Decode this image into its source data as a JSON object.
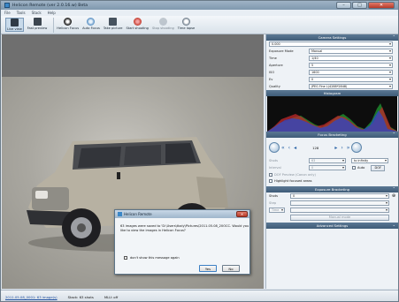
{
  "window": {
    "title": "Helicon Remote (ver 2.0.16.w) Beta"
  },
  "menu": [
    "File",
    "Tools",
    "Stack",
    "Help"
  ],
  "toolbar": {
    "live_view": "Live view",
    "fast_preview": "Fast preview",
    "helicon_focus": "Helicon Focus",
    "auto_focus": "Auto Focus",
    "take_picture": "Take picture",
    "start_shooting": "Start shooting",
    "stop_shooting": "Stop shooting",
    "time_lapse": "Time lapse"
  },
  "camera_settings": {
    "header": "Camera Settings",
    "camera_select": "0.000",
    "fields": [
      {
        "label": "Exposure Mode",
        "value": "Manual"
      },
      {
        "label": "Time",
        "value": "1/40"
      },
      {
        "label": "Aperture",
        "value": "5"
      },
      {
        "label": "ISO",
        "value": "1600"
      },
      {
        "label": "Ev",
        "value": "0"
      },
      {
        "label": "Quality",
        "value": "JPEG Fine L(4288*2848)"
      }
    ]
  },
  "histogram": {
    "header": "Histogram"
  },
  "focus_bracketing": {
    "header": "Focus Bracketing",
    "shot_count": "128",
    "shots_label": "Shots",
    "shots_value": "63",
    "interval_label": "Interval",
    "interval_value": "0",
    "to_infinity": "to infinity",
    "auto_label": "Auto",
    "dof_button": "DOF",
    "dof_preview": "DOF Preview (Canon only)",
    "highlight": "Highlight focused areas"
  },
  "exposure_bracketing": {
    "header": "Exposure Bracketing",
    "shots_label": "Shots",
    "shots_value": "0",
    "step_label": "Step",
    "time_label": "Time",
    "manual_mode": "Manual mode"
  },
  "advanced": {
    "header": "Advanced Settings"
  },
  "dialog": {
    "title": "Helicon Remote",
    "message": "63 images were saved to 'D:\\Users\\tkaly\\Pictures\\2011.05.08_20OCC. Would you like to view the images in Helicon Focus?",
    "dont_show": "don't show this message again",
    "yes": "Yes",
    "no": "No"
  },
  "status": {
    "stack_link": "2011.05.08_0001: 63 image(s)",
    "stack": "Stack: 63 shots",
    "mlu": "MLU: off"
  },
  "colors": {
    "section_header": "#4a6886",
    "histogram_bg": "#0d0d0d",
    "accent": "#3b87c7"
  }
}
